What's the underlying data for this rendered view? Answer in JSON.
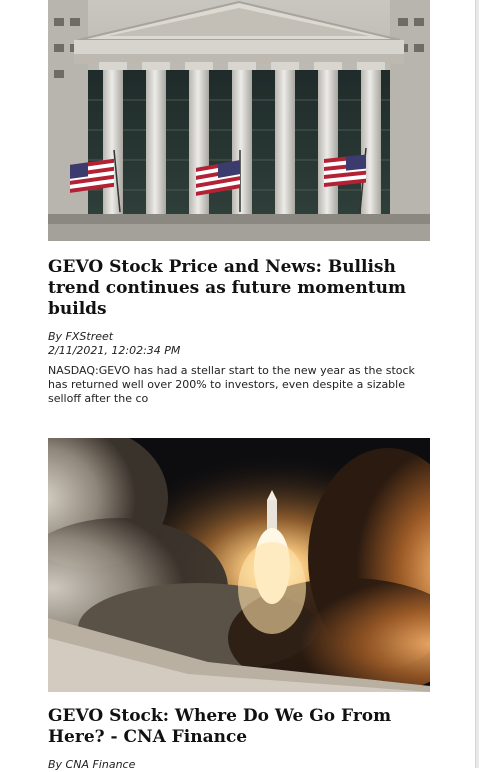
{
  "articles": [
    {
      "image": "stock-exchange-building-photo",
      "title": "GEVO Stock Price and News: Bullish trend continues as future momentum builds",
      "byline": "By FXStreet",
      "date": "2/11/2021, 12:02:34 PM",
      "summary": "NASDAQ:GEVO has had a stellar start to the new year as the stock has returned well over 200% to investors, even despite a sizable selloff after the co"
    },
    {
      "image": "rocket-launch-photo",
      "title": "GEVO Stock: Where Do We Go From Here? - CNA Finance",
      "byline": "By CNA Finance"
    }
  ]
}
